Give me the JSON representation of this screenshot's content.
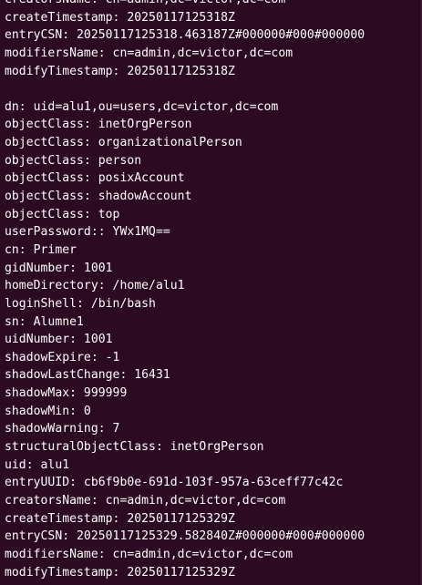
{
  "terminal": {
    "lines": [
      "creatorsName: cn=admin,dc=victor,dc=com",
      "createTimestamp: 20250117125318Z",
      "entryCSN: 20250117125318.463187Z#000000#000#000000",
      "modifiersName: cn=admin,dc=victor,dc=com",
      "modifyTimestamp: 20250117125318Z",
      "",
      "dn: uid=alu1,ou=users,dc=victor,dc=com",
      "objectClass: inetOrgPerson",
      "objectClass: organizationalPerson",
      "objectClass: person",
      "objectClass: posixAccount",
      "objectClass: shadowAccount",
      "objectClass: top",
      "userPassword:: YWx1MQ==",
      "cn: Primer",
      "gidNumber: 1001",
      "homeDirectory: /home/alu1",
      "loginShell: /bin/bash",
      "sn: Alumne1",
      "uidNumber: 1001",
      "shadowExpire: -1",
      "shadowLastChange: 16431",
      "shadowMax: 999999",
      "shadowMin: 0",
      "shadowWarning: 7",
      "structuralObjectClass: inetOrgPerson",
      "uid: alu1",
      "entryUUID: cb6f9b0e-691d-103f-957a-63ceff77c42c",
      "creatorsName: cn=admin,dc=victor,dc=com",
      "createTimestamp: 20250117125329Z",
      "entryCSN: 20250117125329.582840Z#000000#000#000000",
      "modifiersName: cn=admin,dc=victor,dc=com",
      "modifyTimestamp: 20250117125329Z"
    ]
  }
}
